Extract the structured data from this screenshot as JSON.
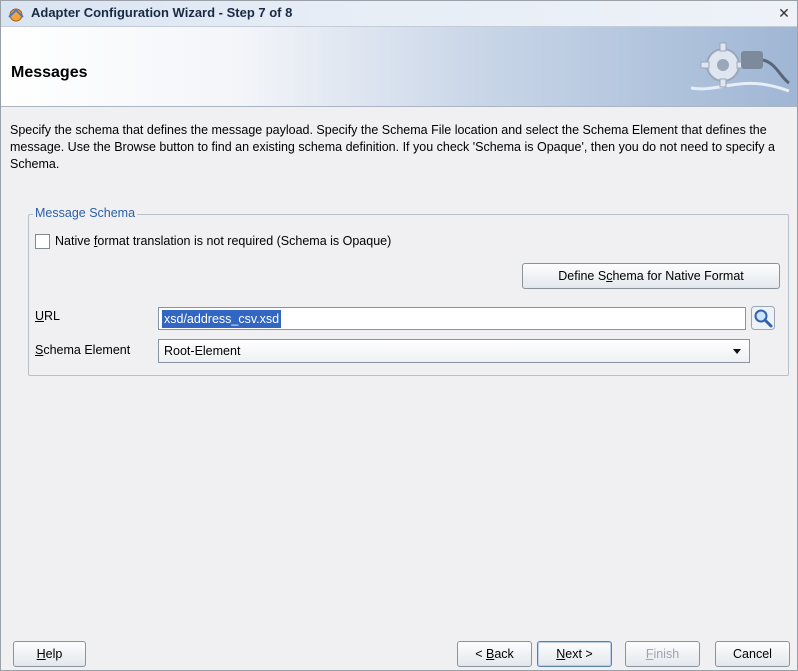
{
  "window": {
    "title": "Adapter Configuration Wizard - Step 7 of 8",
    "close_glyph": "✕"
  },
  "banner": {
    "title": "Messages"
  },
  "description": "Specify the schema that defines the message payload.  Specify the Schema File location and select the Schema Element that defines the message. Use the Browse button to find an existing schema definition. If you check 'Schema is Opaque', then you do not need to specify a Schema.",
  "message_schema": {
    "legend": "Message Schema",
    "opaque_checkbox": {
      "label_pre": "Native ",
      "label_mnemonic": "f",
      "label_post": "ormat translation is not required (Schema is Opaque)",
      "checked": false
    },
    "define_button": {
      "pre": "Define S",
      "mnemonic": "c",
      "post": "hema for Native Format"
    },
    "url": {
      "label_mnemonic": "U",
      "label_post": "RL",
      "value": "xsd/address_csv.xsd"
    },
    "schema_element": {
      "label_mnemonic": "S",
      "label_post": "chema Element",
      "value": "Root-Element"
    }
  },
  "footer": {
    "help": {
      "mnemonic": "H",
      "post": "elp"
    },
    "back": {
      "pre": "< ",
      "mnemonic": "B",
      "post": "ack"
    },
    "next": {
      "mnemonic": "N",
      "post": "ext >"
    },
    "finish": {
      "mnemonic": "F",
      "post": "inish",
      "enabled": false
    },
    "cancel": "Cancel"
  },
  "icons": {
    "title": "adapter-wizard-icon",
    "search": "search-icon",
    "banner": "gear-plug-icon"
  }
}
